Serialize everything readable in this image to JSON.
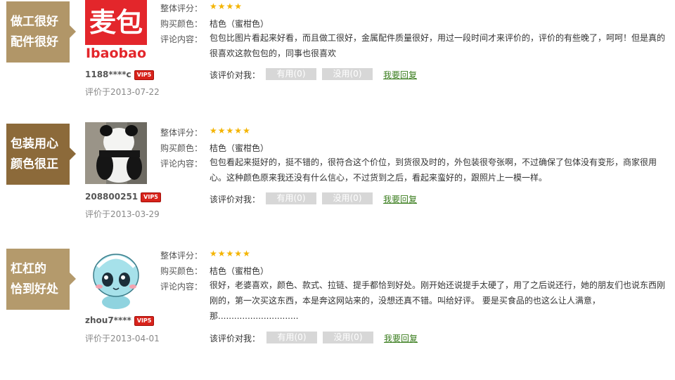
{
  "reviews": [
    {
      "banner_line1": "做工很好",
      "banner_line2": "配件很好",
      "banner_color": "#b19668",
      "avatar_text_top": "麦包",
      "avatar_text_bottom": "Ibaobao",
      "username": "1188****c",
      "vip": "VIP5",
      "date": "评价于2013-07-22",
      "rating_label": "整体评分：",
      "rating": 4,
      "color_label": "购买颜色：",
      "color_value": "桔色（蜜柑色）",
      "content_label": "评论内容：",
      "content": "包包比图片看起来好看，而且做工很好，金属配件质量很好，用过一段时间才来评价的，评价的有些晚了，呵呵！但是真的很喜欢这款包包的，同事也很喜欢",
      "helpful_label": "该评价对我：",
      "useful": "有用(0)",
      "useless": "没用(0)",
      "reply": "我要回复"
    },
    {
      "banner_line1": "包装用心",
      "banner_line2": "颜色很正",
      "banner_color": "#8c6a3a",
      "username": "208800251",
      "vip": "VIP5",
      "date": "评价于2013-03-29",
      "rating_label": "整体评分：",
      "rating": 5,
      "color_label": "购买颜色：",
      "color_value": "桔色（蜜柑色）",
      "content_label": "评论内容：",
      "content": "包包看起来挺好的，挺不错的，很符合这个价位，到货很及时的，外包装很夸张啊，不过确保了包体没有变形，商家很用心。这种颜色原来我还没有什么信心，不过货到之后，看起来蛮好的，跟照片上一模一样。",
      "helpful_label": "该评价对我：",
      "useful": "有用(0)",
      "useless": "没用(0)",
      "reply": "我要回复"
    },
    {
      "banner_line1": "杠杠的",
      "banner_line2": "恰到好处",
      "banner_color": "#b49a6c",
      "username": "zhou7****",
      "vip": "VIP5",
      "date": "评价于2013-04-01",
      "rating_label": "整体评分：",
      "rating": 5,
      "color_label": "购买颜色：",
      "color_value": "桔色（蜜柑色）",
      "content_label": "评论内容：",
      "content": "很好，老婆喜欢，颜色、款式、拉链、提手都恰到好处。刚开始还说提手太硬了，用了之后说还行，她的朋友们也说东西刚刚的，第一次买这东西，本是奔这网站来的，没想还真不错。叫给好评。 要是买食品的也这么让人满意，那..............................",
      "helpful_label": "该评价对我：",
      "useful": "有用(0)",
      "useless": "没用(0)",
      "reply": "我要回复"
    }
  ]
}
